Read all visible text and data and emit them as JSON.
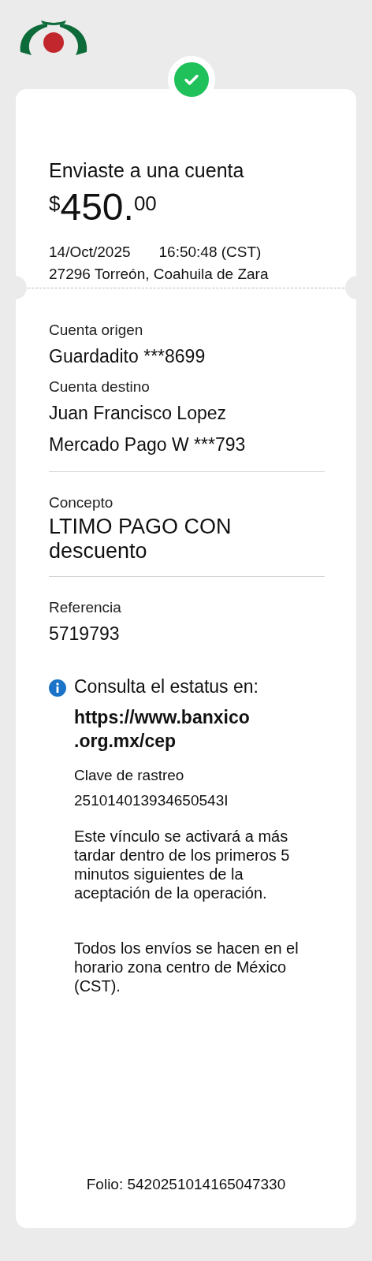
{
  "header": {
    "title": "Enviaste a una cuenta",
    "currency": "$",
    "amount": "450.",
    "cents": "00",
    "date": "14/Oct/2025",
    "time": "16:50:48 (CST)",
    "location": "27296 Torreón, Coahuila de Zara"
  },
  "sections": [
    {
      "fields": [
        {
          "label": "Cuenta origen",
          "lines": [
            "Guardadito ***8699"
          ]
        },
        {
          "label": "Cuenta destino",
          "lines": [
            "Juan Francisco Lopez",
            "Mercado Pago W ***793"
          ]
        }
      ]
    },
    {
      "fields": [
        {
          "label": "Concepto",
          "lines": [
            "LTIMO PAGO CON descuento"
          ],
          "large": true
        }
      ]
    },
    {
      "fields": [
        {
          "label": "Referencia",
          "lines": [
            "5719793"
          ]
        }
      ]
    }
  ],
  "status": {
    "title": "Consulta el estatus en:",
    "link": "https://www.banxico .org.mx/cep",
    "tracking_label": "Clave de rastreo",
    "tracking_value": "251014013934650543I",
    "notes": [
      "Este vínculo se activará a más tardar dentro de los primeros 5 minutos siguientes de la aceptación de la operación.",
      "Todos los envíos se hacen en el horario zona centro de México (CST)."
    ]
  },
  "folio": "Folio: 5420251014165047330"
}
